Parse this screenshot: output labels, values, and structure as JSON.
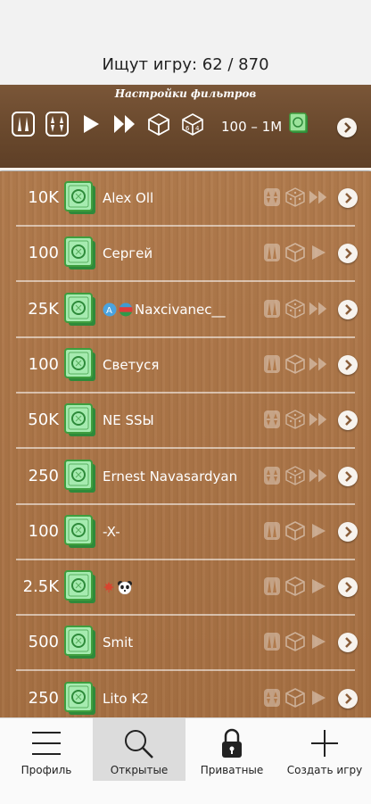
{
  "header": {
    "status_text": "Ищут игру: 62 / 870"
  },
  "filter": {
    "title": "Настройки фильтров",
    "range": "100 – 1M",
    "icons": [
      "backgammon-long-icon",
      "backgammon-short-icon",
      "play-icon",
      "fast-forward-icon",
      "cube-icon",
      "dice-icon"
    ]
  },
  "rows": [
    {
      "amount": "10K",
      "name": "Alex Oll",
      "badges": [
        "short-icon",
        "dice-icon",
        "ff-icon"
      ]
    },
    {
      "amount": "100",
      "name": "Сергей",
      "badges": [
        "long-icon",
        "cube-icon",
        "play-icon"
      ]
    },
    {
      "amount": "25K",
      "name": "Naxcivanec__",
      "prefix_icons": [
        "letter-a-badge-icon",
        "azerbaijan-flag-icon"
      ],
      "badges": [
        "long-icon",
        "dice-icon",
        "ff-icon"
      ]
    },
    {
      "amount": "100",
      "name": "Светуся",
      "badges": [
        "long-icon",
        "cube-icon",
        "ff-icon"
      ]
    },
    {
      "amount": "50K",
      "name": "NE SSЫ",
      "badges": [
        "short-icon",
        "dice-icon",
        "ff-icon"
      ]
    },
    {
      "amount": "250",
      "name": "Ernest Navasardyan",
      "badges": [
        "short-icon",
        "dice-icon",
        "ff-icon"
      ]
    },
    {
      "amount": "100",
      "name": "-X-",
      "badges": [
        "long-icon",
        "cube-icon",
        "play-icon"
      ]
    },
    {
      "amount": "2.5K",
      "name": "",
      "prefix_icons": [
        "maple-leaf-icon",
        "panda-icon"
      ],
      "badges": [
        "long-icon",
        "cube-icon",
        "play-icon"
      ]
    },
    {
      "amount": "500",
      "name": "Smit",
      "badges": [
        "long-icon",
        "cube-icon",
        "play-icon"
      ]
    },
    {
      "amount": "250",
      "name": "Lito K2",
      "badges": [
        "short-icon",
        "cube-icon",
        "play-icon"
      ]
    }
  ],
  "tabs": [
    {
      "label": "Профиль",
      "icon": "menu-icon",
      "active": false
    },
    {
      "label": "Открытые",
      "icon": "search-icon",
      "active": true
    },
    {
      "label": "Приватные",
      "icon": "lock-icon",
      "active": false
    },
    {
      "label": "Создать игру",
      "icon": "plus-icon",
      "active": false
    }
  ],
  "colors": {
    "wood": "#a87246",
    "bar": "#6b4a2e",
    "money": "#4fb04f"
  }
}
